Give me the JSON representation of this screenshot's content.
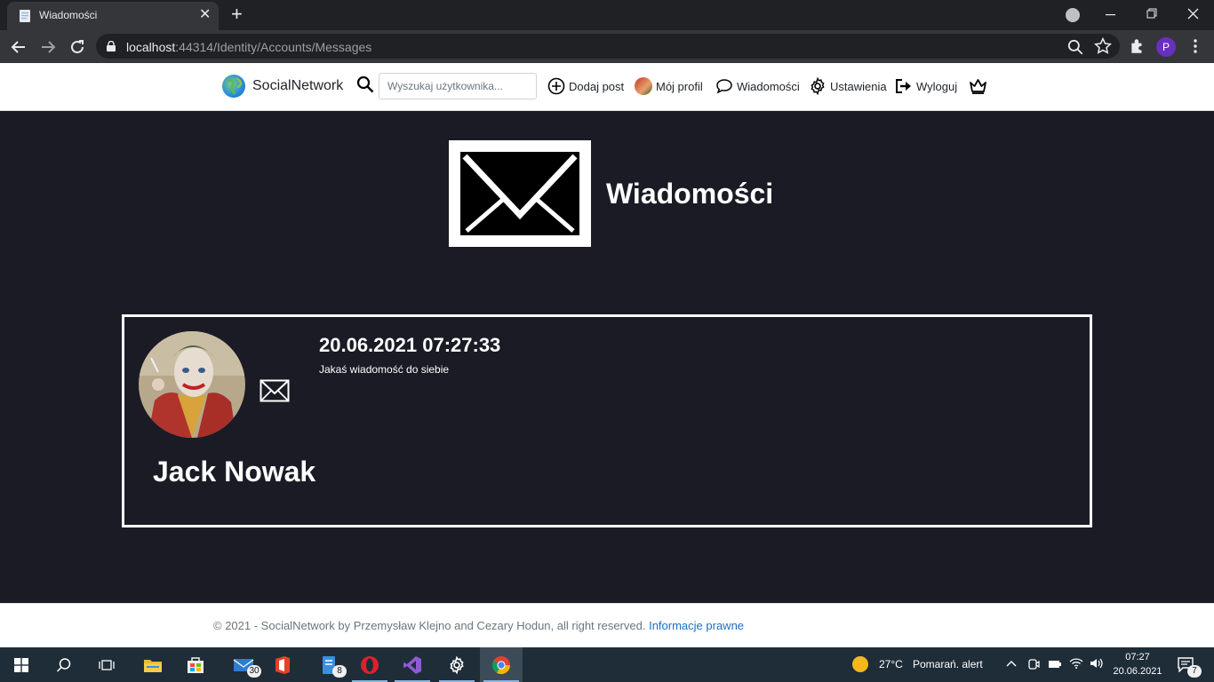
{
  "browser": {
    "tab_title": "Wiadomości",
    "tab_close": "✕",
    "new_tab": "+",
    "url_host": "localhost",
    "url_rest": ":44314/Identity/Accounts/Messages",
    "profile_initial": "P"
  },
  "header": {
    "brand": "SocialNetwork",
    "search_placeholder": "Wyszukaj użytkownika...",
    "nav": {
      "add_post": "Dodaj post",
      "my_profile": "Mój profil",
      "messages": "Wiadomości",
      "settings": "Ustawienia",
      "logout": "Wyloguj"
    }
  },
  "page": {
    "title": "Wiadomości"
  },
  "messages": [
    {
      "sender": "Jack Nowak",
      "date": "20.06.2021 07:27:33",
      "text": "Jakaś wiadomość do siebie"
    }
  ],
  "footer": {
    "text": "© 2021 - SocialNetwork by Przemysław Klejno and Cezary Hodun, all right reserved.",
    "link": "Informacje prawne"
  },
  "taskbar": {
    "mail_badge": "30",
    "files_badge": "8",
    "weather_temp": "27°C",
    "weather_alert": "Pomarań. alert",
    "time": "07:27",
    "date": "20.06.2021",
    "notifications": "7"
  },
  "colors": {
    "page_bg": "#1b1b26",
    "chrome_dark": "#202124",
    "chrome_toolbar": "#35363a",
    "link": "#1b6ec2",
    "taskbar": "#1f2d38"
  }
}
